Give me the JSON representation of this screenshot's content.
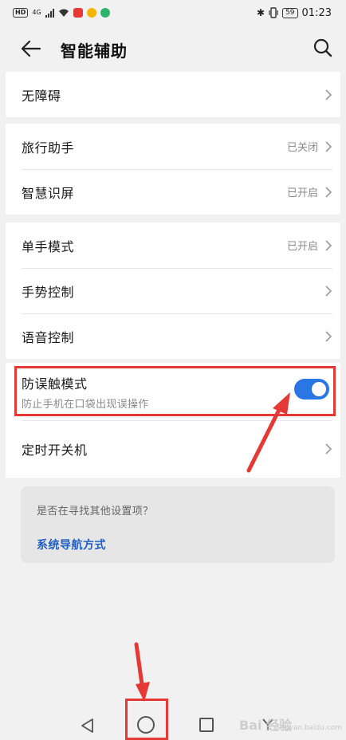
{
  "status_bar": {
    "hd": "HD",
    "network": "4G",
    "battery": "59",
    "time": "01:23",
    "bluetooth_icon": "bluetooth-icon",
    "app_icon_colors": [
      "#e53935",
      "#f5b400",
      "#2db46a"
    ]
  },
  "header": {
    "title": "智能辅助",
    "back_icon": "arrow-left-icon",
    "search_icon": "search-icon"
  },
  "sections": [
    {
      "items": [
        {
          "label": "无障碍",
          "status": ""
        }
      ]
    },
    {
      "items": [
        {
          "label": "旅行助手",
          "status": "已关闭"
        },
        {
          "label": "智慧识屏",
          "status": "已开启"
        }
      ]
    },
    {
      "items": [
        {
          "label": "单手模式",
          "status": "已开启"
        },
        {
          "label": "手势控制",
          "status": ""
        },
        {
          "label": "语音控制",
          "status": ""
        }
      ]
    }
  ],
  "toggle_item": {
    "label": "防误触模式",
    "description": "防止手机在口袋出现误操作",
    "enabled": true
  },
  "timer_item": {
    "label": "定时开关机"
  },
  "suggestion": {
    "title": "是否在寻找其他设置项？",
    "link": "系统导航方式"
  },
  "colors": {
    "accent": "#2a76e4",
    "link": "#1f5fc4",
    "annotation": "#e53935",
    "background": "#f1f1f1"
  },
  "watermark": {
    "text": "Bai 经验",
    "sub": "jingyan.baidu.com"
  }
}
